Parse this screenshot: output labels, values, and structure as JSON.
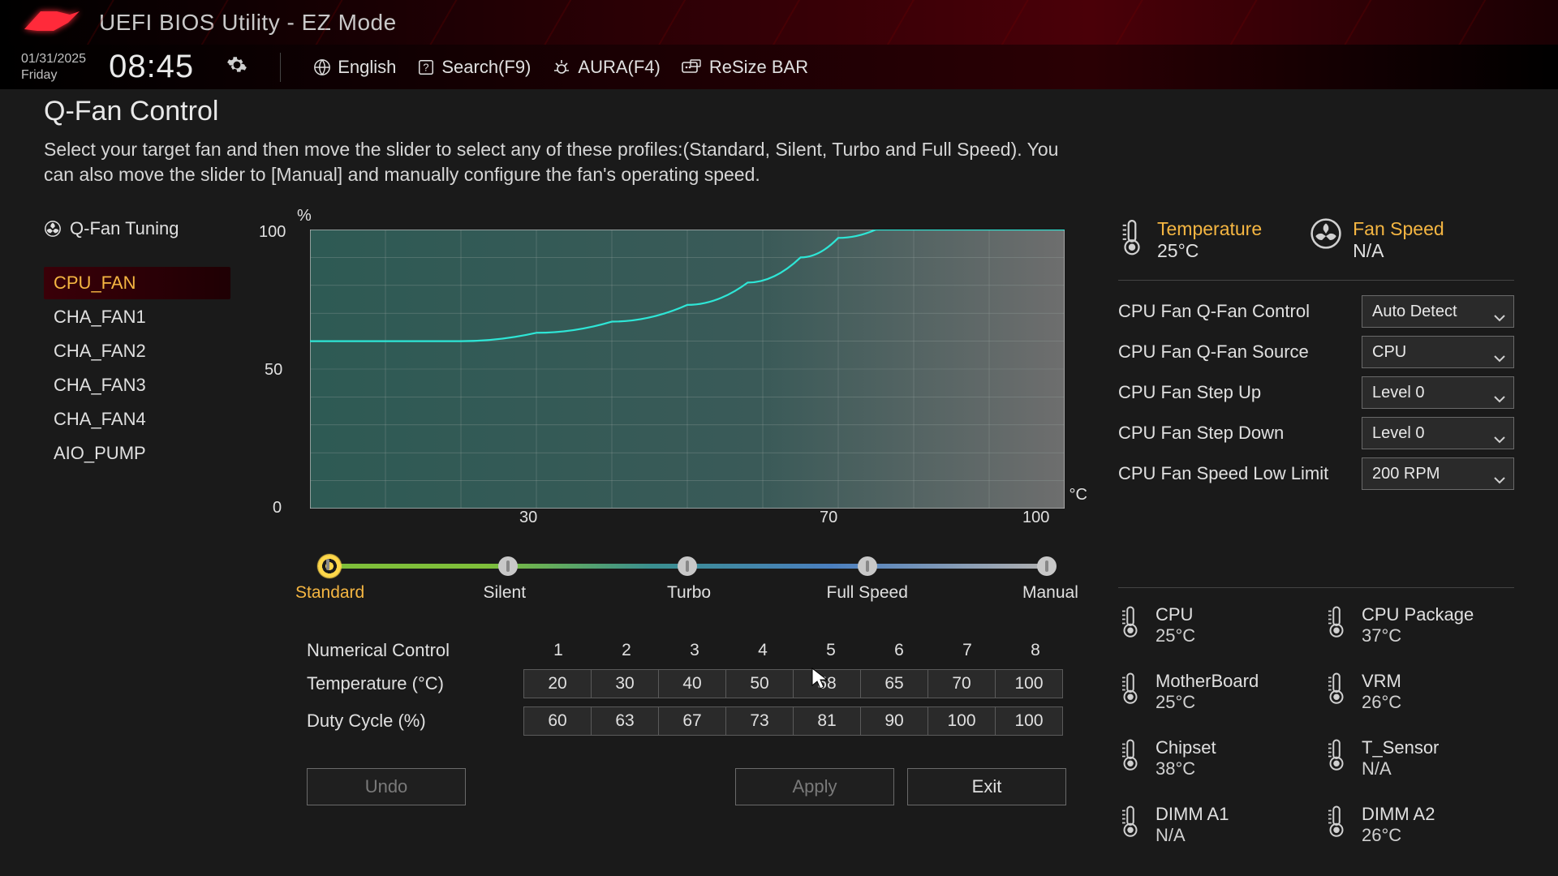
{
  "header": {
    "title": "UEFI BIOS Utility - EZ Mode",
    "date": "01/31/2025",
    "day": "Friday",
    "time": "08:45",
    "language": "English",
    "search": "Search(F9)",
    "aura": "AURA(F4)",
    "resize_bar": "ReSize BAR"
  },
  "page": {
    "title": "Q-Fan Control",
    "description": "Select your target fan and then move the slider to select any of these profiles:(Standard, Silent, Turbo and Full Speed). You can also move the slider to [Manual] and manually configure the fan's operating speed.",
    "tuning_label": "Q-Fan Tuning"
  },
  "fan_tabs": [
    "CPU_FAN",
    "CHA_FAN1",
    "CHA_FAN2",
    "CHA_FAN3",
    "CHA_FAN4",
    "AIO_PUMP"
  ],
  "chart_data": {
    "type": "line",
    "xlabel": "°C",
    "ylabel": "%",
    "xlim": [
      0,
      100
    ],
    "ylim": [
      0,
      100
    ],
    "x_ticks": [
      0,
      30,
      70,
      100
    ],
    "y_ticks": [
      0,
      50,
      100
    ],
    "series": [
      {
        "name": "CPU_FAN",
        "x": [
          0,
          20,
          30,
          40,
          50,
          58,
          65,
          70,
          75,
          100
        ],
        "y": [
          60,
          60,
          63,
          67,
          73,
          81,
          90,
          97,
          100,
          100
        ],
        "color": "#2ee6d6"
      }
    ]
  },
  "profiles": {
    "options": [
      "Standard",
      "Silent",
      "Turbo",
      "Full Speed",
      "Manual"
    ],
    "selected": "Standard"
  },
  "numerical": {
    "title": "Numerical Control",
    "columns": [
      "1",
      "2",
      "3",
      "4",
      "5",
      "6",
      "7",
      "8"
    ],
    "temperature_label": "Temperature (°C)",
    "temperature": [
      "20",
      "30",
      "40",
      "50",
      "58",
      "65",
      "70",
      "100"
    ],
    "duty_label": "Duty Cycle (%)",
    "duty": [
      "60",
      "63",
      "67",
      "73",
      "81",
      "90",
      "100",
      "100"
    ]
  },
  "buttons": {
    "undo": "Undo",
    "apply": "Apply",
    "exit": "Exit"
  },
  "status": {
    "temperature_label": "Temperature",
    "temperature": "25°C",
    "fanspeed_label": "Fan Speed",
    "fanspeed": "N/A"
  },
  "settings": [
    {
      "label": "CPU Fan Q-Fan Control",
      "value": "Auto Detect"
    },
    {
      "label": "CPU Fan Q-Fan Source",
      "value": "CPU"
    },
    {
      "label": "CPU Fan Step Up",
      "value": "Level 0"
    },
    {
      "label": "CPU Fan Step Down",
      "value": "Level 0"
    },
    {
      "label": "CPU Fan Speed Low Limit",
      "value": "200 RPM"
    }
  ],
  "sensors": [
    {
      "name": "CPU",
      "value": "25°C"
    },
    {
      "name": "CPU Package",
      "value": "37°C"
    },
    {
      "name": "MotherBoard",
      "value": "25°C"
    },
    {
      "name": "VRM",
      "value": "26°C"
    },
    {
      "name": "Chipset",
      "value": "38°C"
    },
    {
      "name": "T_Sensor",
      "value": "N/A"
    },
    {
      "name": "DIMM A1",
      "value": "N/A"
    },
    {
      "name": "DIMM A2",
      "value": "26°C"
    }
  ]
}
